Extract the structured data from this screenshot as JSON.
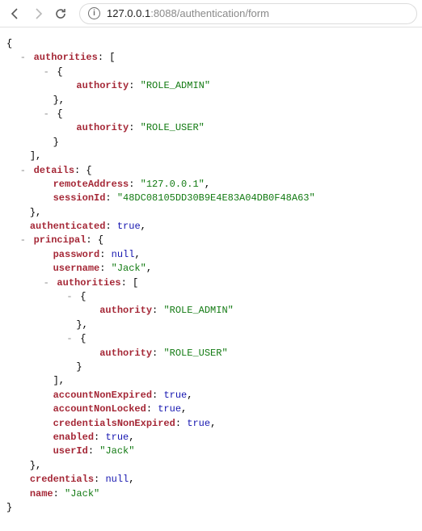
{
  "browser": {
    "url_host": "127.0.0.1",
    "url_port": ":8088",
    "url_path": "/authentication/form"
  },
  "json": {
    "authorities": [
      {
        "authority": "ROLE_ADMIN"
      },
      {
        "authority": "ROLE_USER"
      }
    ],
    "details": {
      "remoteAddress": "127.0.0.1",
      "sessionId": "48DC08105DD30B9E4E83A04DB0F48A63"
    },
    "authenticated": true,
    "principal": {
      "password": null,
      "username": "Jack",
      "authorities": [
        {
          "authority": "ROLE_ADMIN"
        },
        {
          "authority": "ROLE_USER"
        }
      ],
      "accountNonExpired": true,
      "accountNonLocked": true,
      "credentialsNonExpired": true,
      "enabled": true,
      "userId": "Jack"
    },
    "credentials": null,
    "name": "Jack"
  },
  "labels": {
    "authorities": "authorities",
    "authority": "authority",
    "details": "details",
    "remoteAddress": "remoteAddress",
    "sessionId": "sessionId",
    "authenticated": "authenticated",
    "principal": "principal",
    "password": "password",
    "username": "username",
    "accountNonExpired": "accountNonExpired",
    "accountNonLocked": "accountNonLocked",
    "credentialsNonExpired": "credentialsNonExpired",
    "enabled": "enabled",
    "userId": "userId",
    "credentials": "credentials",
    "name": "name"
  }
}
